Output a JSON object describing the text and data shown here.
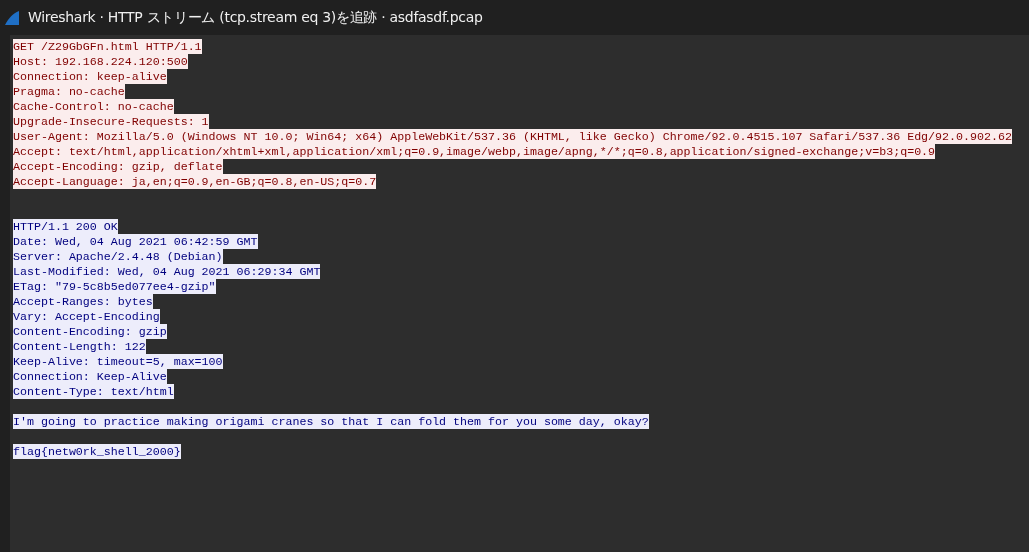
{
  "window": {
    "title": "Wireshark · HTTP ストリーム (tcp.stream eq 3)を追跡 · asdfasdf.pcap"
  },
  "stream": [
    {
      "kind": "client",
      "lines": [
        "GET /Z29GbGFn.html HTTP/1.1",
        "Host: 192.168.224.120:500",
        "Connection: keep-alive",
        "Pragma: no-cache",
        "Cache-Control: no-cache",
        "Upgrade-Insecure-Requests: 1",
        "User-Agent: Mozilla/5.0 (Windows NT 10.0; Win64; x64) AppleWebKit/537.36 (KHTML, like Gecko) Chrome/92.0.4515.107 Safari/537.36 Edg/92.0.902.62",
        "Accept: text/html,application/xhtml+xml,application/xml;q=0.9,image/webp,image/apng,*/*;q=0.8,application/signed-exchange;v=b3;q=0.9",
        "Accept-Encoding: gzip, deflate",
        "Accept-Language: ja,en;q=0.9,en-GB;q=0.8,en-US;q=0.7"
      ]
    },
    {
      "kind": "server",
      "lines": [
        "HTTP/1.1 200 OK",
        "Date: Wed, 04 Aug 2021 06:42:59 GMT",
        "Server: Apache/2.4.48 (Debian)",
        "Last-Modified: Wed, 04 Aug 2021 06:29:34 GMT",
        "ETag: \"79-5c8b5ed077ee4-gzip\"",
        "Accept-Ranges: bytes",
        "Vary: Accept-Encoding",
        "Content-Encoding: gzip",
        "Content-Length: 122",
        "Keep-Alive: timeout=5, max=100",
        "Connection: Keep-Alive",
        "Content-Type: text/html"
      ]
    },
    {
      "kind": "server",
      "lines": [
        "I'm going to practice making origami cranes so that I can fold them for you some day, okay?"
      ]
    },
    {
      "kind": "server",
      "lines": [
        "flag{netw0rk_shell_2000}"
      ]
    }
  ]
}
